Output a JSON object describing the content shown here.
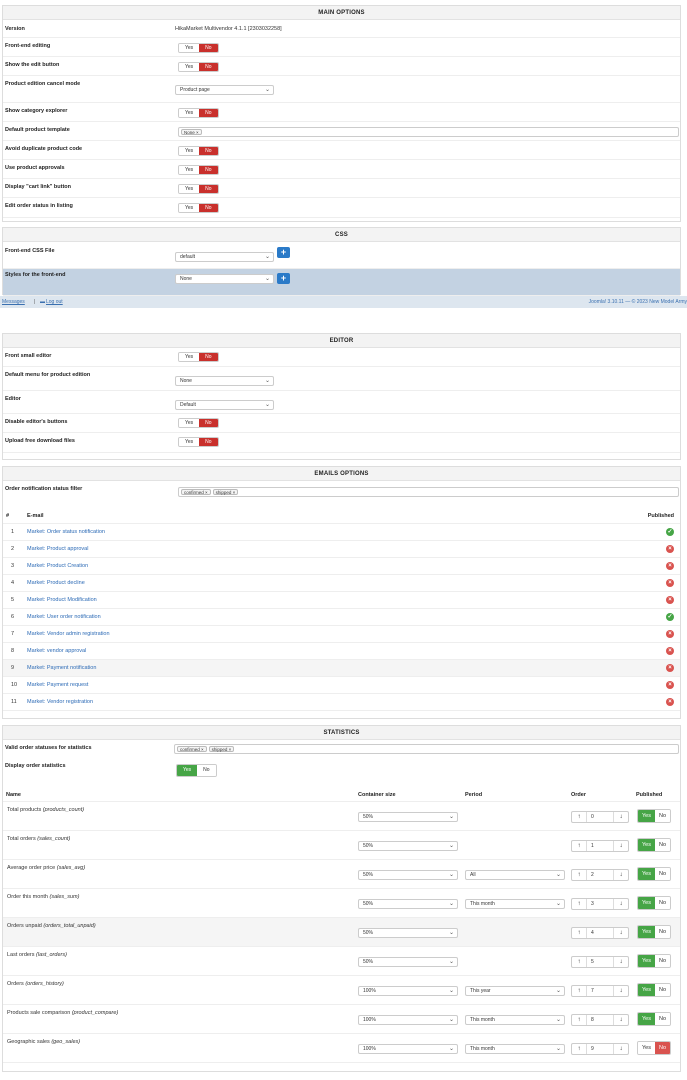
{
  "main": {
    "title": "MAIN OPTIONS",
    "version_label": "Version",
    "version_value": "HikaMarket Multivendor 4.1.1 [2303032258]",
    "yes": "Yes",
    "no": "No",
    "rows": [
      {
        "label": "Front-end editing"
      },
      {
        "label": "Show the edit button"
      },
      {
        "label": "Product edition cancel mode",
        "select": "Product page"
      },
      {
        "label": "Show category explorer"
      },
      {
        "label": "Default product template",
        "tag": "None"
      },
      {
        "label": "Avoid duplicate product code"
      },
      {
        "label": "Use product approvals"
      },
      {
        "label": "Display \"cart link\" button"
      },
      {
        "label": "Edit order status in listing"
      }
    ]
  },
  "css": {
    "title": "CSS",
    "file_label": "Front-end CSS File",
    "file_value": "default",
    "styles_label": "Styles for the front-end",
    "styles_value": "None"
  },
  "statusbar": {
    "messages": "Messages",
    "logout": "Log out",
    "right": "Joomla! 3.10.11 — © 2023 New Model Army"
  },
  "editor": {
    "title": "EDITOR",
    "rows": [
      {
        "label": "Front small editor"
      },
      {
        "label": "Default menu for product edition",
        "select": "None"
      },
      {
        "label": "Editor",
        "select": "Default"
      },
      {
        "label": "Disable editor's buttons"
      },
      {
        "label": "Upload free download files"
      }
    ]
  },
  "emails": {
    "title": "EMAILS OPTIONS",
    "filter_label": "Order notification status filter",
    "filter_tags": [
      "confirmed",
      "shipped"
    ],
    "col_num": "#",
    "col_email": "E-mail",
    "col_published": "Published",
    "items": [
      {
        "n": "1",
        "name": "Market: Order status notification",
        "published": true
      },
      {
        "n": "2",
        "name": "Market: Product approval",
        "published": false
      },
      {
        "n": "3",
        "name": "Market: Product Creation",
        "published": false
      },
      {
        "n": "4",
        "name": "Market: Product decline",
        "published": false
      },
      {
        "n": "5",
        "name": "Market: Product Modification",
        "published": false
      },
      {
        "n": "6",
        "name": "Market: User order notification",
        "published": true
      },
      {
        "n": "7",
        "name": "Market: Vendor admin registration",
        "published": false
      },
      {
        "n": "8",
        "name": "Market: vendor approval",
        "published": false
      },
      {
        "n": "9",
        "name": "Market: Payment notification",
        "published": false
      },
      {
        "n": "10",
        "name": "Market: Payment request",
        "published": false
      },
      {
        "n": "11",
        "name": "Market: Vendor registration",
        "published": false
      }
    ]
  },
  "stats": {
    "title": "STATISTICS",
    "valid_label": "Valid order statuses for statistics",
    "valid_tags": [
      "confirmed",
      "shipped"
    ],
    "display_label": "Display order statistics",
    "col_name": "Name",
    "col_size": "Container size",
    "col_period": "Period",
    "col_order": "Order",
    "col_published": "Published",
    "items": [
      {
        "name": "Total products ",
        "key": "(products_count)",
        "size": "50%",
        "period": "",
        "order": "0",
        "published": true
      },
      {
        "name": "Total orders ",
        "key": "(sales_count)",
        "size": "50%",
        "period": "",
        "order": "1",
        "published": true
      },
      {
        "name": "Average order price ",
        "key": "(sales_avg)",
        "size": "50%",
        "period": "All",
        "order": "2",
        "published": true
      },
      {
        "name": "Order this month ",
        "key": "(sales_sum)",
        "size": "50%",
        "period": "This month",
        "order": "3",
        "published": true
      },
      {
        "name": "Orders unpaid ",
        "key": "(orders_total_unpaid)",
        "size": "50%",
        "period": "",
        "order": "4",
        "published": true
      },
      {
        "name": "Last orders ",
        "key": "(last_orders)",
        "size": "50%",
        "period": "",
        "order": "5",
        "published": true
      },
      {
        "name": "Orders ",
        "key": "(orders_history)",
        "size": "100%",
        "period": "This year",
        "order": "7",
        "published": true
      },
      {
        "name": "Products sale comparison ",
        "key": "(product_compare)",
        "size": "100%",
        "period": "This month",
        "order": "8",
        "published": true
      },
      {
        "name": "Geographic sales ",
        "key": "(geo_sales)",
        "size": "100%",
        "period": "This month",
        "order": "9",
        "published": false
      }
    ]
  }
}
